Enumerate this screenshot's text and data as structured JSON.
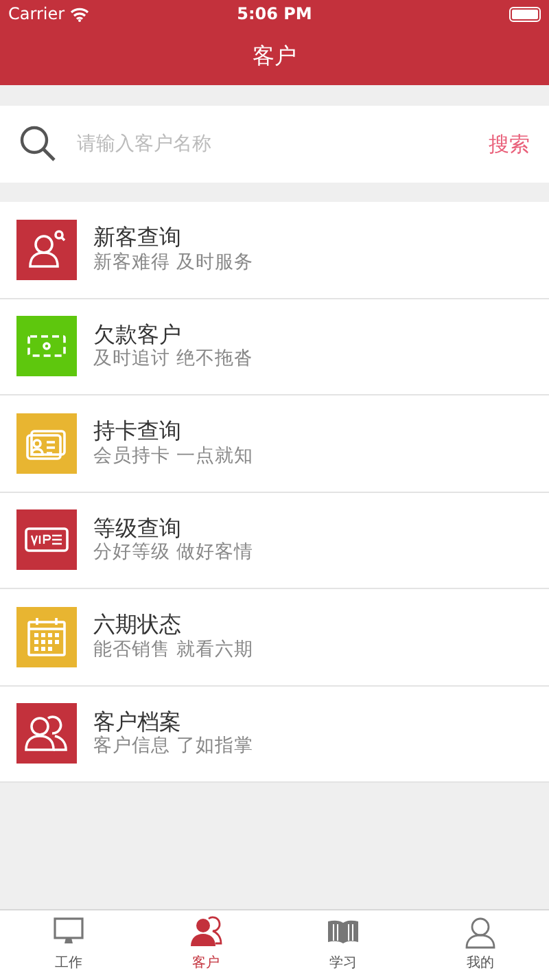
{
  "status_bar": {
    "carrier": "Carrier",
    "time": "5:06 PM"
  },
  "nav_bar": {
    "title": "客户"
  },
  "search": {
    "placeholder": "请输入客户名称",
    "button": "搜索"
  },
  "menu": [
    {
      "kind": "person-search",
      "color": "#c3313c",
      "title": "新客查询",
      "subtitle": "新客难得 及时服务"
    },
    {
      "kind": "money",
      "color": "#5ec70d",
      "title": "欠款客户",
      "subtitle": "及时追讨 绝不拖沓"
    },
    {
      "kind": "card",
      "color": "#e8b531",
      "title": "持卡查询",
      "subtitle": "会员持卡 一点就知"
    },
    {
      "kind": "vip",
      "color": "#c3313c",
      "title": "等级查询",
      "subtitle": "分好等级 做好客情"
    },
    {
      "kind": "calendar",
      "color": "#e8b531",
      "title": "六期状态",
      "subtitle": "能否销售 就看六期"
    },
    {
      "kind": "people",
      "color": "#c3313c",
      "title": "客户档案",
      "subtitle": "客户信息 了如指掌"
    }
  ],
  "tab_bar": [
    {
      "kind": "monitor",
      "label": "工作",
      "selected": false
    },
    {
      "kind": "people",
      "label": "客户",
      "selected": true
    },
    {
      "kind": "book",
      "label": "学习",
      "selected": false
    },
    {
      "kind": "person",
      "label": "我的",
      "selected": false
    }
  ]
}
